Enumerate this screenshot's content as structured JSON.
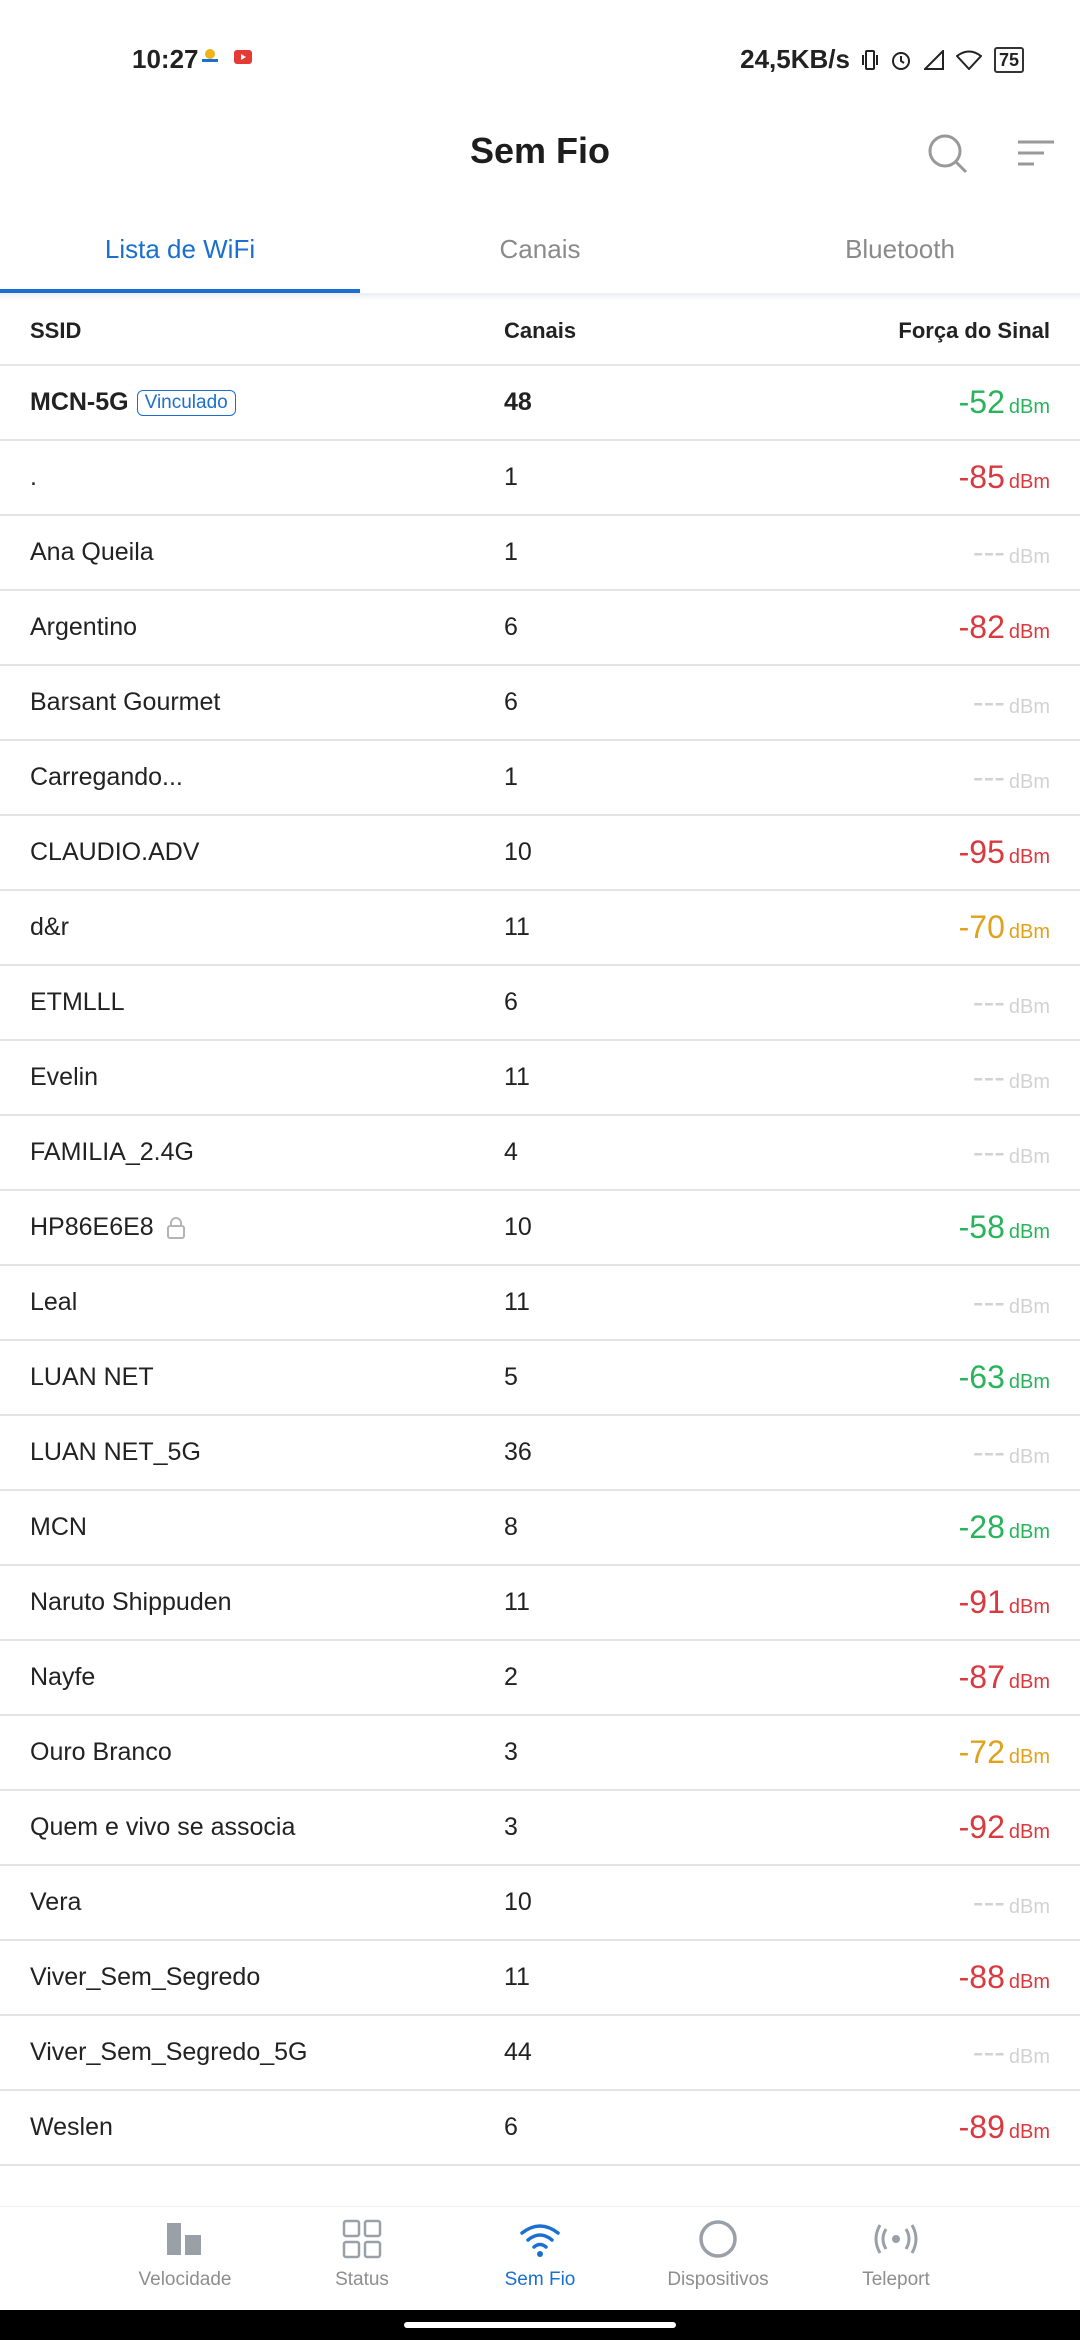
{
  "status_bar": {
    "time": "10:27",
    "net_speed": "24,5KB/s",
    "battery": "75"
  },
  "header": {
    "title": "Sem Fio"
  },
  "tabs": [
    {
      "label": "Lista de WiFi",
      "active": true
    },
    {
      "label": "Canais",
      "active": false
    },
    {
      "label": "Bluetooth",
      "active": false
    }
  ],
  "table": {
    "col_ssid": "SSID",
    "col_channel": "Canais",
    "col_signal": "Força do Sinal",
    "unit": "dBm",
    "rows": [
      {
        "ssid": "MCN-5G",
        "badge": "Vinculado",
        "channel": "48",
        "signal": "-52",
        "level": "good"
      },
      {
        "ssid": ".",
        "channel": "1",
        "signal": "-85",
        "level": "bad"
      },
      {
        "ssid": "Ana Queila",
        "channel": "1",
        "signal": "---",
        "level": "none"
      },
      {
        "ssid": "Argentino",
        "channel": "6",
        "signal": "-82",
        "level": "bad"
      },
      {
        "ssid": "Barsant Gourmet",
        "channel": "6",
        "signal": "---",
        "level": "none"
      },
      {
        "ssid": "Carregando...",
        "channel": "1",
        "signal": "---",
        "level": "none"
      },
      {
        "ssid": "CLAUDIO.ADV",
        "channel": "10",
        "signal": "-95",
        "level": "bad"
      },
      {
        "ssid": "d&r",
        "channel": "11",
        "signal": "-70",
        "level": "mid"
      },
      {
        "ssid": "ETMLLL",
        "channel": "6",
        "signal": "---",
        "level": "none"
      },
      {
        "ssid": "Evelin",
        "channel": "11",
        "signal": "---",
        "level": "none"
      },
      {
        "ssid": "FAMILIA_2.4G",
        "channel": "4",
        "signal": "---",
        "level": "none"
      },
      {
        "ssid": "HP86E6E8",
        "lock": true,
        "channel": "10",
        "signal": "-58",
        "level": "good"
      },
      {
        "ssid": "Leal",
        "channel": "11",
        "signal": "---",
        "level": "none"
      },
      {
        "ssid": "LUAN NET",
        "channel": "5",
        "signal": "-63",
        "level": "good"
      },
      {
        "ssid": "LUAN NET_5G",
        "channel": "36",
        "signal": "---",
        "level": "none"
      },
      {
        "ssid": "MCN",
        "channel": "8",
        "signal": "-28",
        "level": "good"
      },
      {
        "ssid": "Naruto Shippuden",
        "channel": "11",
        "signal": "-91",
        "level": "bad"
      },
      {
        "ssid": "Nayfe",
        "channel": "2",
        "signal": "-87",
        "level": "bad"
      },
      {
        "ssid": "Ouro Branco",
        "channel": "3",
        "signal": "-72",
        "level": "mid"
      },
      {
        "ssid": "Quem e vivo se associa",
        "channel": "3",
        "signal": "-92",
        "level": "bad"
      },
      {
        "ssid": "Vera",
        "channel": "10",
        "signal": "---",
        "level": "none"
      },
      {
        "ssid": "Viver_Sem_Segredo",
        "channel": "11",
        "signal": "-88",
        "level": "bad"
      },
      {
        "ssid": "Viver_Sem_Segredo_5G",
        "channel": "44",
        "signal": "---",
        "level": "none"
      },
      {
        "ssid": "Weslen",
        "channel": "6",
        "signal": "-89",
        "level": "bad"
      }
    ]
  },
  "bottom_nav": [
    {
      "label": "Velocidade",
      "icon": "speed-bars-icon",
      "active": false
    },
    {
      "label": "Status",
      "icon": "grid-icon",
      "active": false
    },
    {
      "label": "Sem Fio",
      "icon": "wifi-icon",
      "active": true
    },
    {
      "label": "Dispositivos",
      "icon": "circle-icon",
      "active": false
    },
    {
      "label": "Teleport",
      "icon": "teleport-icon",
      "active": false
    }
  ],
  "colors": {
    "accent": "#1a6fd1",
    "good": "#29b45c",
    "bad": "#d83a3f",
    "mid": "#e0a21c",
    "none": "#d2d2d2"
  }
}
